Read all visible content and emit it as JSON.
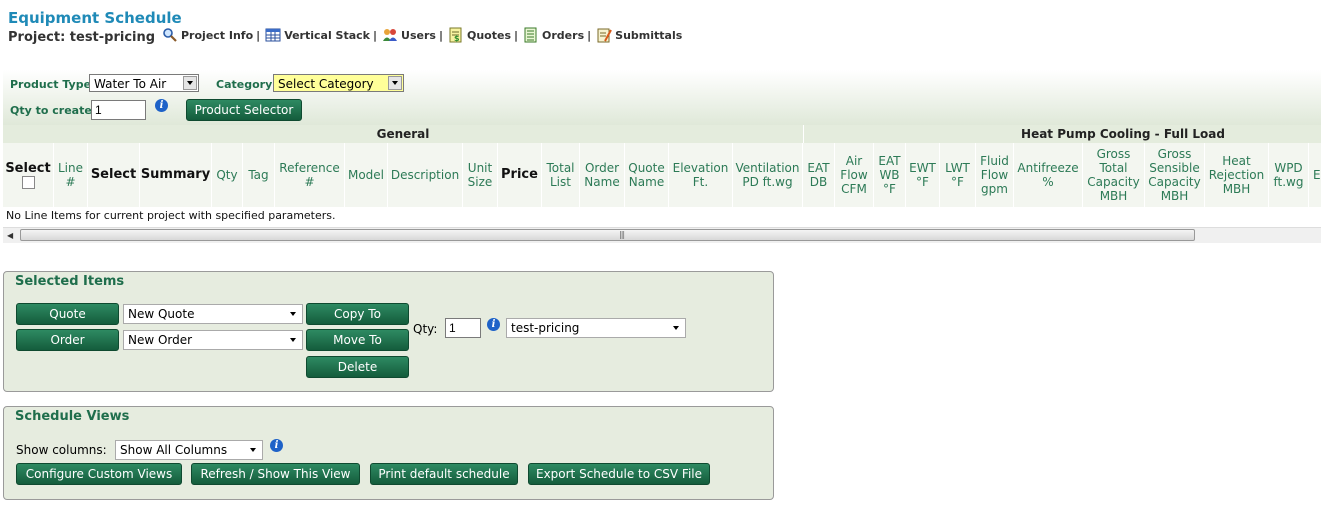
{
  "header": {
    "title": "Equipment Schedule",
    "project_label": "Project: test-pricing",
    "nav": [
      {
        "label": "Project Info",
        "icon": "magnifier-icon"
      },
      {
        "label": "Vertical Stack",
        "icon": "table-icon"
      },
      {
        "label": "Users",
        "icon": "users-icon"
      },
      {
        "label": "Quotes",
        "icon": "quotes-icon"
      },
      {
        "label": "Orders",
        "icon": "orders-icon"
      },
      {
        "label": "Submittals",
        "icon": "submittals-icon"
      }
    ],
    "separator": "|"
  },
  "filters": {
    "product_type_label": "Product Type",
    "product_type_value": "Water To Air",
    "category_label": "Category",
    "category_value": "Select Category",
    "qty_label": "Qty to create",
    "qty_value": "1",
    "product_selector_button": "Product Selector"
  },
  "table": {
    "groups": {
      "general": "General",
      "cooling": "Heat Pump Cooling - Full Load"
    },
    "select_header": "Select",
    "columns": {
      "line": "Line #",
      "select": "Select",
      "summary": "Summary",
      "qty": "Qty",
      "tag": "Tag",
      "reference": "Reference #",
      "model": "Model",
      "description": "Description",
      "unit_size": "Unit Size",
      "price": "Price",
      "total_list": "Total List",
      "order_name": "Order Name",
      "quote_name": "Quote Name",
      "elevation": "Elevation Ft.",
      "ventilation": "Ventilation PD ft.wg",
      "eat_db": "EAT DB",
      "air_flow": "Air Flow CFM",
      "eat_wb": "EAT WB °F",
      "ewt": "EWT °F",
      "lwt": "LWT °F",
      "fluid_flow": "Fluid Flow gpm",
      "antifreeze": "Antifreeze %",
      "gross_total": "Gross Total Capacity MBH",
      "gross_sensible": "Gross Sensible Capacity MBH",
      "heat_rejection": "Heat Rejection MBH",
      "wpd": "WPD ft.wg",
      "partial": "E"
    },
    "empty_message": "No Line Items for current project with specified parameters."
  },
  "selected_items": {
    "title": "Selected Items",
    "quote_button": "Quote",
    "order_button": "Order",
    "quote_select": "New Quote",
    "order_select": "New Order",
    "copy_button": "Copy To",
    "move_button": "Move To",
    "delete_button": "Delete",
    "qty_label": "Qty:",
    "qty_value": "1",
    "project_select": "test-pricing"
  },
  "schedule_views": {
    "title": "Schedule Views",
    "show_columns_label": "Show columns:",
    "show_columns_value": "Show All Columns",
    "configure_button": "Configure Custom Views",
    "refresh_button": "Refresh / Show This View",
    "print_button": "Print default schedule",
    "export_button": "Export Schedule to CSV File"
  },
  "colors": {
    "accent": "#1f6e4c",
    "title": "#1f8ab7",
    "button": "#1e6e4a",
    "highlight": "#ffff99"
  }
}
